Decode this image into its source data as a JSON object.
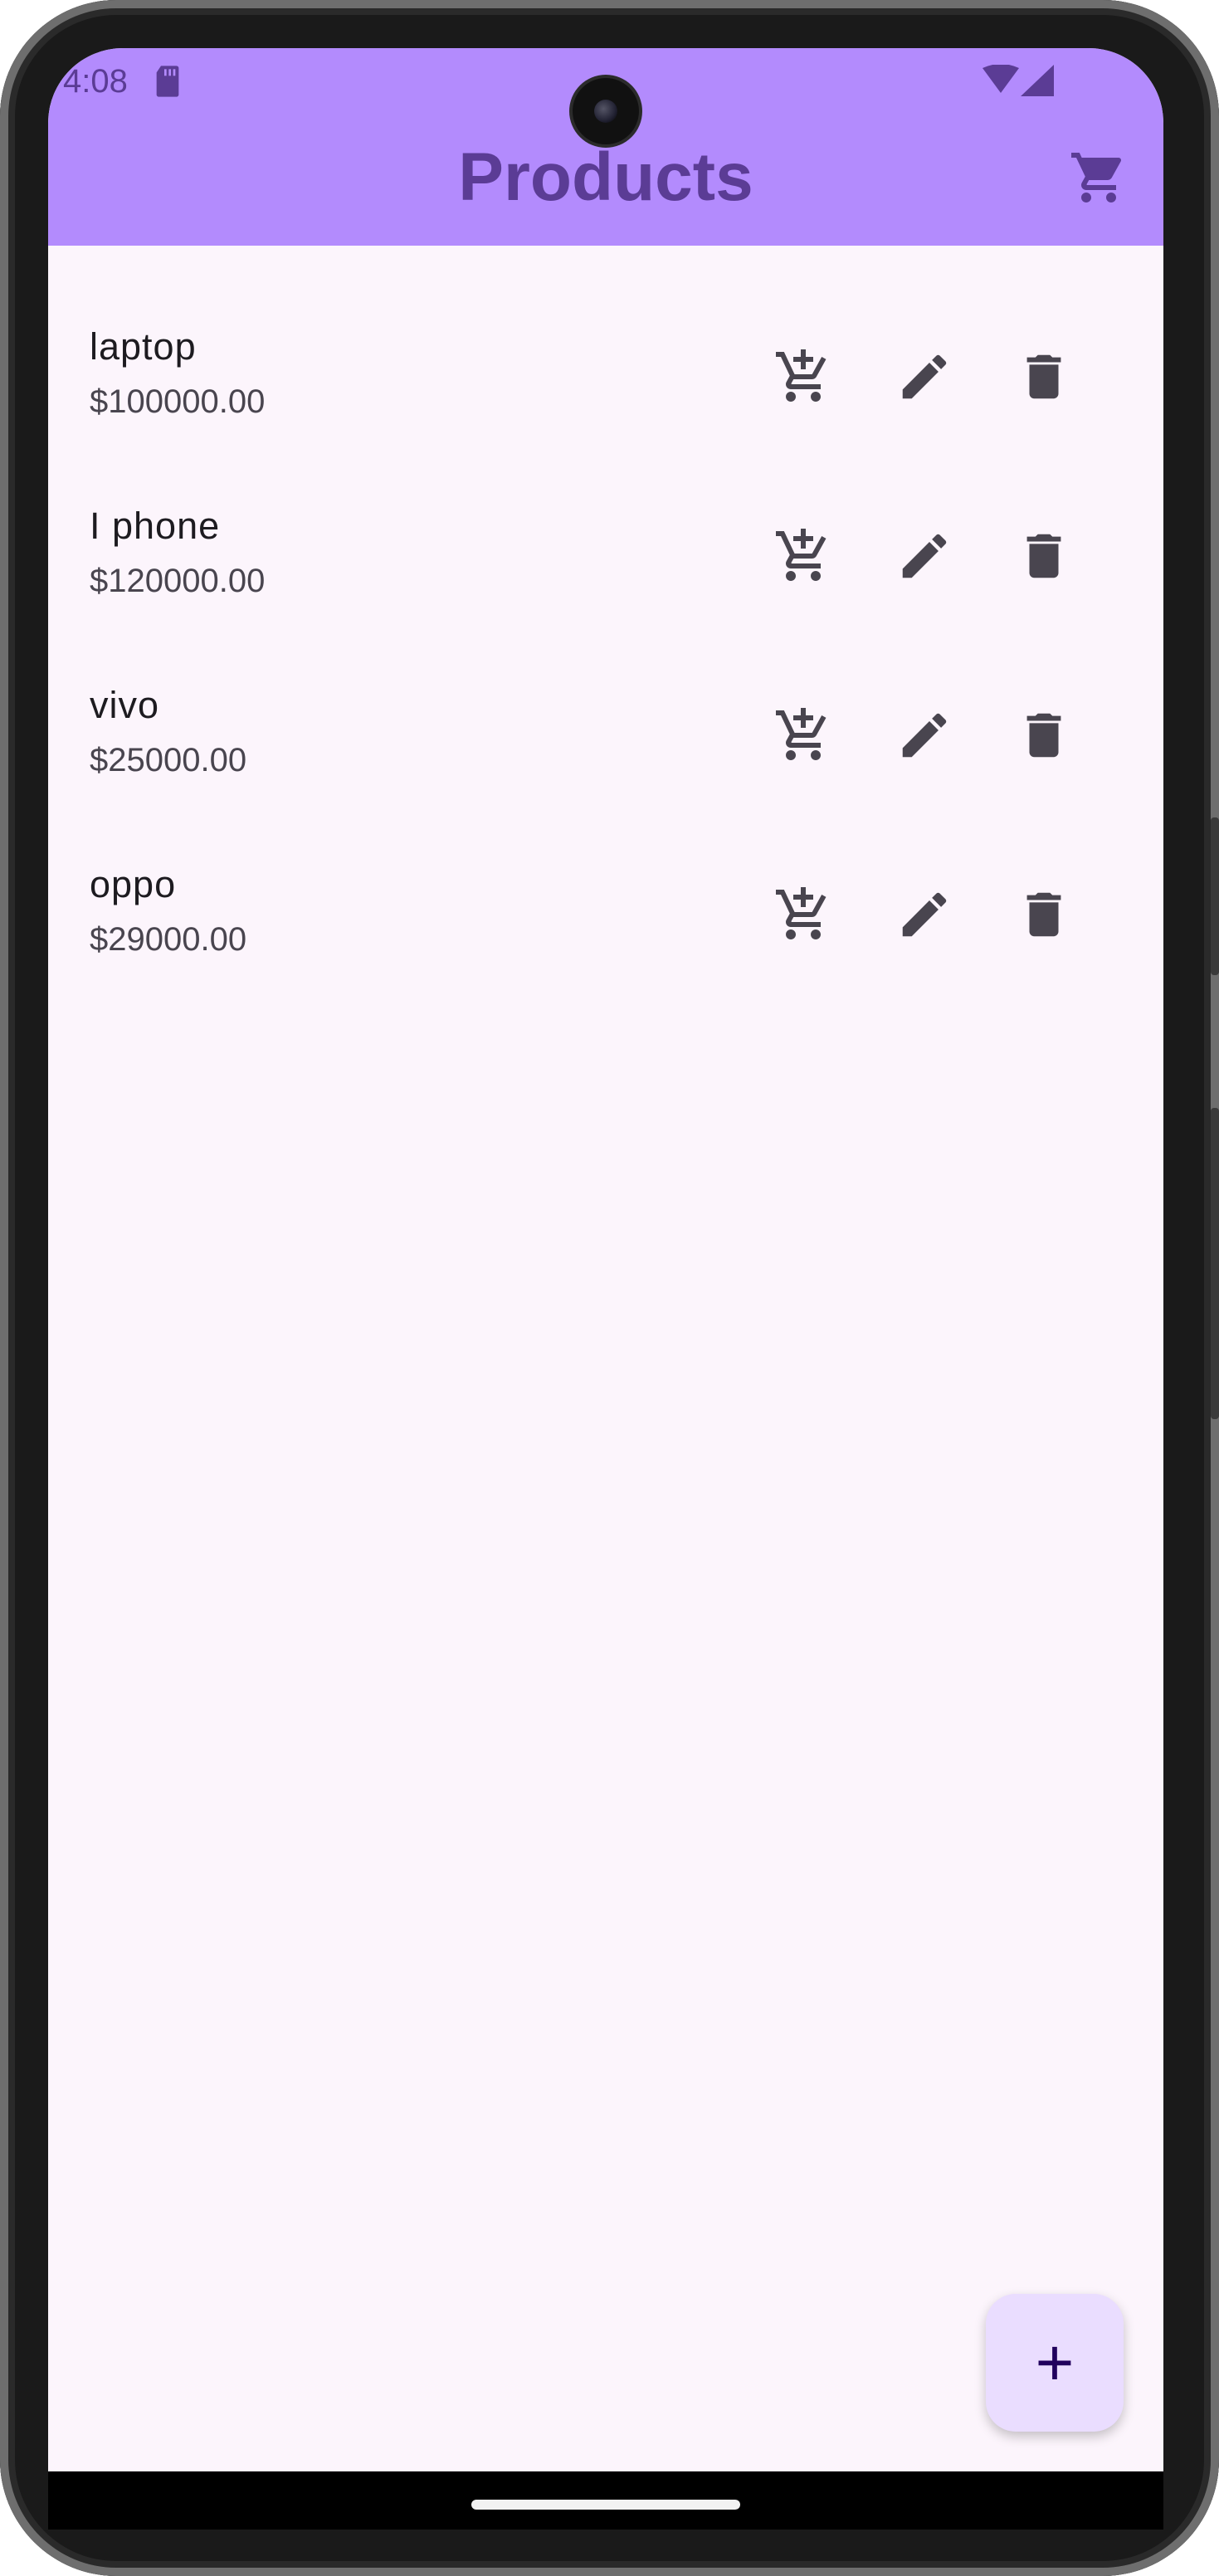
{
  "status_bar": {
    "time": "4:08"
  },
  "app_bar": {
    "title": "Products"
  },
  "products": [
    {
      "name": "laptop",
      "price": "$100000.00"
    },
    {
      "name": "I phone",
      "price": "$120000.00"
    },
    {
      "name": "vivo",
      "price": "$25000.00"
    },
    {
      "name": "oppo",
      "price": "$29000.00"
    }
  ],
  "fab": {
    "label": "+"
  },
  "icons": {
    "app_bar_action": "shopping-cart-icon",
    "row_actions": [
      "add-shopping-cart-icon",
      "edit-icon",
      "delete-icon"
    ]
  },
  "colors": {
    "app_bar": "#b38bfd",
    "title": "#5b3c95",
    "background": "#fcf5fc",
    "fab": "#eaddff",
    "icon": "#49454f"
  }
}
